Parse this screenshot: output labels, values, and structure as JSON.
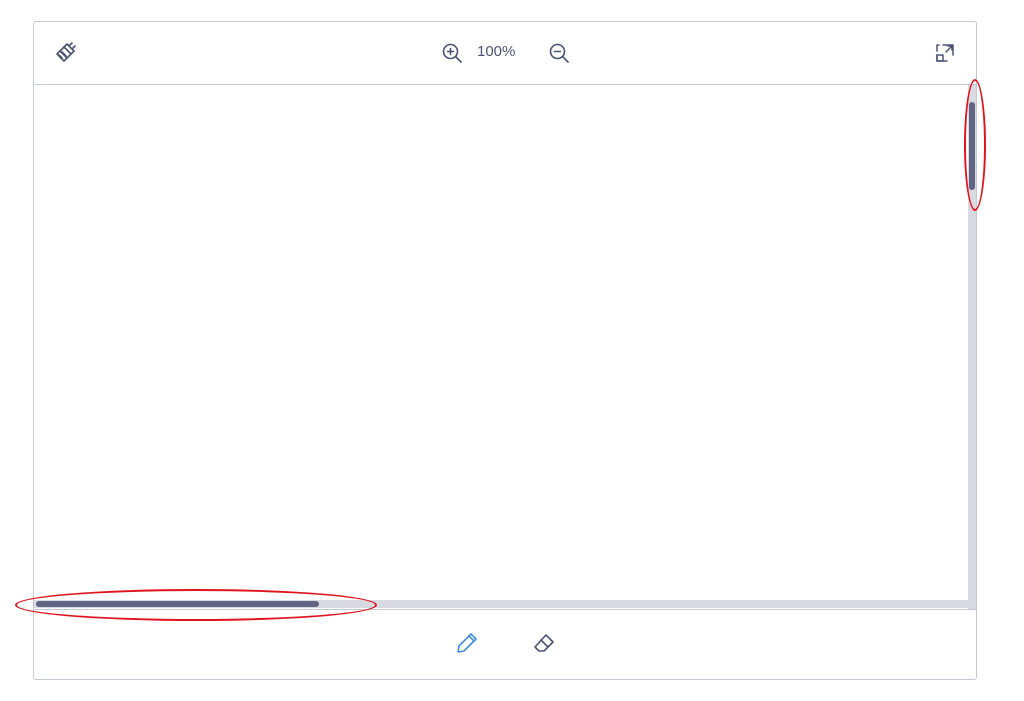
{
  "toolbar": {
    "clear_icon": "brush-icon",
    "zoom_in_icon": "zoom-in-icon",
    "zoom_level": "100%",
    "zoom_out_icon": "zoom-out-icon",
    "fullscreen_icon": "expand-icon"
  },
  "scroll": {
    "vertical_thumb_position": 0.03,
    "horizontal_thumb_position": 0.0
  },
  "tools": {
    "pencil_icon": "pencil-icon",
    "eraser_icon": "eraser-icon",
    "active_tool": "pencil"
  },
  "colors": {
    "accent": "#3f8de0",
    "icon": "#4d5372",
    "border": "#c5c7d4",
    "scroll_track": "#d8d9e1",
    "scroll_thumb": "#5f6583",
    "annotation": "#e0141e"
  }
}
